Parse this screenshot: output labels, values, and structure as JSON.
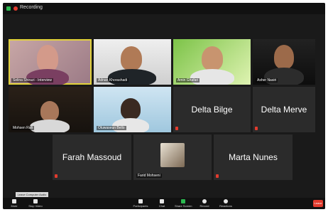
{
  "recording": {
    "label": "Recording"
  },
  "tiles": [
    {
      "name": "Selina Shirazi - Interview"
    },
    {
      "name": "Adnan Khorashadi"
    },
    {
      "name": "Amin Ghafari"
    },
    {
      "name": "Asher Nasiri"
    },
    {
      "name": "Mohsen Rafi"
    },
    {
      "name": "Oluwaseun Bello"
    },
    {
      "name": "Delta Bilge"
    },
    {
      "name": "Delta Merve"
    },
    {
      "name": "Farah Massoud"
    },
    {
      "name": "Farid Mohseni"
    },
    {
      "name": "Marta Nunes"
    }
  ],
  "toolbar": {
    "unmute": "Mute",
    "video": "Stop Video",
    "participants": "Participants",
    "chat": "Chat",
    "share": "Share Screen",
    "record": "Record",
    "reactions": "Reactions",
    "end": "Leave"
  },
  "tooltip": {
    "label": "Leave Computer Audio"
  },
  "colors": {
    "active_speaker": "#e2d23b",
    "mic_muted": "#e23b2e",
    "share_green": "#2bb84f"
  }
}
